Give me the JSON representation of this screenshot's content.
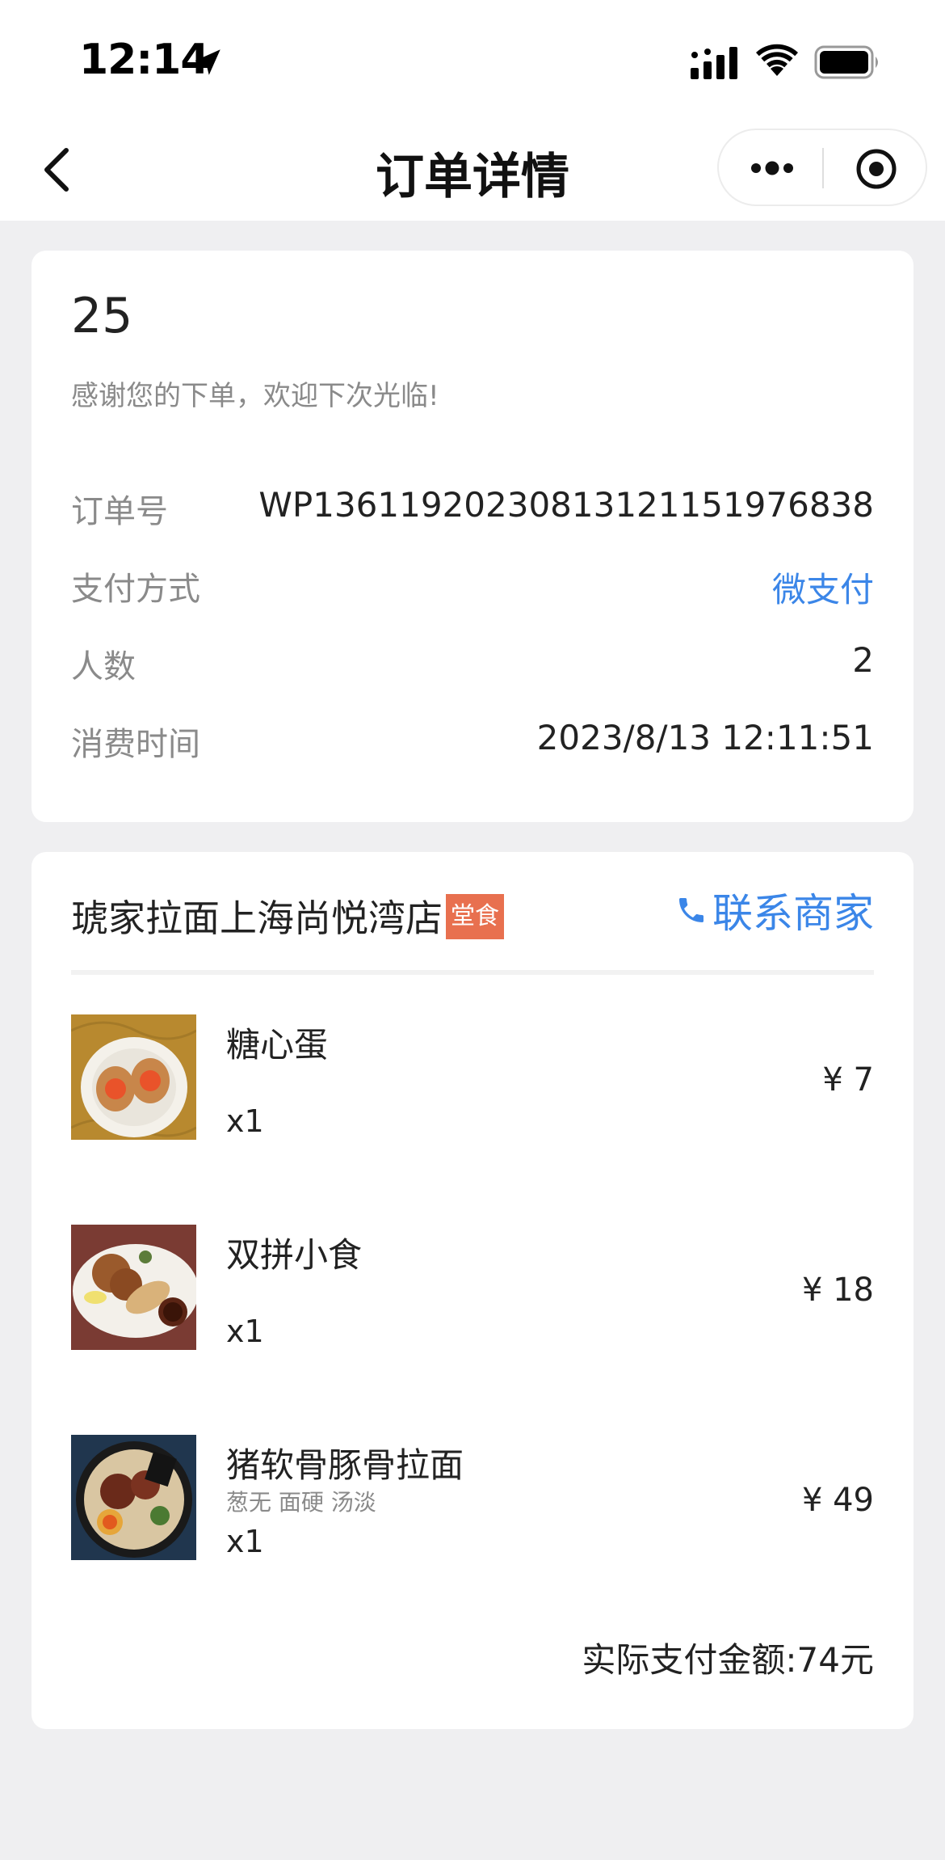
{
  "status_bar": {
    "time": "12:14",
    "icons": [
      "location-arrow-icon",
      "cellular-signal-icon",
      "wifi-icon",
      "battery-icon"
    ]
  },
  "nav": {
    "title": "订单详情",
    "icons": [
      "back-chevron-icon",
      "more-dots-icon",
      "target-circle-icon"
    ]
  },
  "order": {
    "pickup_number": "25",
    "thanks_message": "感谢您的下单，欢迎下次光临!",
    "rows": [
      {
        "label": "订单号",
        "value": "WP136119202308131211519768​38"
      },
      {
        "label": "支付方式",
        "value": "微支付"
      },
      {
        "label": "人数",
        "value": "2"
      },
      {
        "label": "消费时间",
        "value": "2023/8/13 12:11:51"
      }
    ]
  },
  "shop": {
    "name": "琥家拉面上海尚悦湾店",
    "badge": "堂食",
    "contact_label": "联系商家",
    "items": [
      {
        "name": "糖心蛋",
        "spec": "",
        "qty": "x1",
        "price": "¥ 7"
      },
      {
        "name": "双拼小食",
        "spec": "",
        "qty": "x1",
        "price": "¥ 18"
      },
      {
        "name": "猪软骨豚骨拉面",
        "spec": "葱无 面硬 汤淡",
        "qty": "x1",
        "price": "¥ 49"
      }
    ],
    "total": "实际支付金额:74元"
  },
  "colors": {
    "accent_blue": "#3b86e8",
    "badge_orange": "#e8704f",
    "background": "#efeff1"
  }
}
